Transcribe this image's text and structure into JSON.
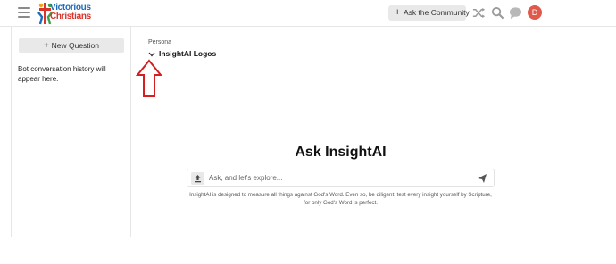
{
  "header": {
    "logo": {
      "line1": "Victorious",
      "line2": "Christians"
    },
    "ask_community_label": "Ask the Community",
    "avatar_initial": "D"
  },
  "sidebar": {
    "new_question_label": "New Question",
    "history_text": "Bot conversation history will appear here."
  },
  "persona": {
    "label": "Persona",
    "selected": "InsightAI Logos"
  },
  "main": {
    "title": "Ask InsightAI",
    "input_placeholder": "Ask, and let's explore...",
    "disclaimer": "InsightAI is designed to measure all things against God's Word. Even so, be diligent: test every insight yourself by Scripture, for only God's Word is perfect."
  },
  "colors": {
    "logo_blue": "#1e6bb8",
    "logo_red": "#d9342b",
    "avatar_bg": "#e0594a",
    "annotation_red": "#d42020",
    "button_bg": "#e9e9e9"
  },
  "icons": [
    "menu-icon",
    "shuffle-icon",
    "search-icon",
    "chat-icon",
    "upload-icon",
    "send-icon",
    "chevron-down-icon",
    "plus-icon"
  ]
}
